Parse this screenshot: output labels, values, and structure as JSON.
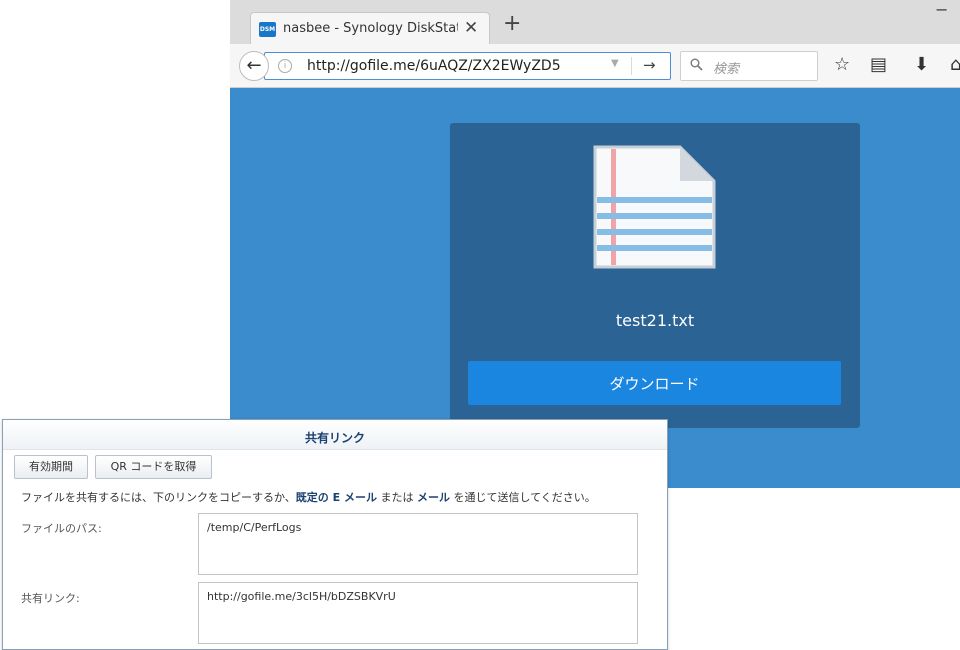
{
  "browser": {
    "tab": {
      "favicon": "DSM",
      "title": "nasbee - Synology DiskStati",
      "close": "✕"
    },
    "new_tab": "+",
    "minimize": "−",
    "back": "←",
    "url": "http://gofile.me/6uAQZ/ZX2EWyZD5",
    "url_dropdown": "▼",
    "go": "→",
    "search_placeholder": "検索",
    "toolbar_icons": {
      "bookmark": "☆",
      "reader": "▤",
      "download": "⬇",
      "home": "⌂"
    }
  },
  "share_page": {
    "filename": "test21.txt",
    "download_label": "ダウンロード"
  },
  "dialog": {
    "title": "共有リンク",
    "validity_button": "有効期間",
    "qr_button": "QR コードを取得",
    "info_prefix": "ファイルを共有するには、下のリンクをコピーするか、",
    "info_link_default_email": "既定の E メール",
    "info_mid": " または ",
    "info_link_email": "メール",
    "info_suffix": " を通じて送信してください。",
    "path_label": "ファイルのパス:",
    "path_value": "/temp/C/PerfLogs",
    "link_label": "共有リンク:",
    "link_value": "http://gofile.me/3cl5H/bDZSBKVrU"
  },
  "colors": {
    "page_background": "#3b8ccd",
    "card": "#2b6494",
    "download_button": "#1a86e0",
    "dialog_title": "#1b4170"
  }
}
